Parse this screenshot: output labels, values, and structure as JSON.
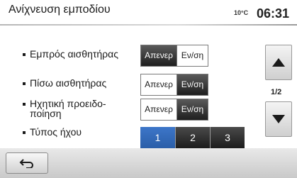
{
  "header": {
    "title": "Ανίχνευση εμποδίου",
    "temperature": "10°C",
    "time": "06:31"
  },
  "rows": [
    {
      "label": "Εμπρός αισθητήρας",
      "off_label": "Απενερ",
      "on_label": "Εν/ση",
      "active": "off"
    },
    {
      "label": "Πίσω αισθητήρας",
      "off_label": "Απενερ",
      "on_label": "Εν/ση",
      "active": "on"
    },
    {
      "label_line1": "Ηχητική προειδο-",
      "label_line2": "ποίηση",
      "off_label": "Απενερ",
      "on_label": "Εν/ση",
      "active": "on"
    },
    {
      "label": "Τύπος ήχου",
      "options": [
        "1",
        "2",
        "3"
      ],
      "selected": "1"
    }
  ],
  "pagination": {
    "indicator": "1/2",
    "up_icon": "arrow-up-icon",
    "down_icon": "arrow-down-icon"
  },
  "footer": {
    "back_icon": "return-arrow-icon"
  },
  "colors": {
    "active_dark": "#1f1f1f",
    "selected_blue": "#2f66b3"
  }
}
